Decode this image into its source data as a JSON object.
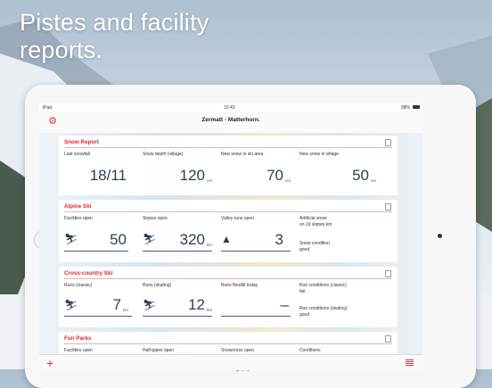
{
  "headline": {
    "line1": "Pistes and facility",
    "line2": "reports."
  },
  "status_bar": {
    "device": "iPad",
    "time": "10:43",
    "battery": "98%"
  },
  "nav": {
    "title": "Zermatt - Matterhorn.",
    "settings_icon": "gear-icon"
  },
  "cards": {
    "snow_report": {
      "title": "Snow Report",
      "items": [
        {
          "label": "Last snowfall",
          "value": "18/11",
          "unit": ""
        },
        {
          "label": "Snow depth (village)",
          "value": "120",
          "unit": "cm"
        },
        {
          "label": "New snow in ski area",
          "value": "70",
          "unit": "cm"
        },
        {
          "label": "New snow in village",
          "value": "50",
          "unit": "cm"
        }
      ]
    },
    "alpine_ski": {
      "title": "Alpine Ski",
      "items": [
        {
          "label": "Facilities open",
          "value": "50",
          "unit": ""
        },
        {
          "label": "Slopes open",
          "value": "320",
          "unit": "km"
        },
        {
          "label": "Valley runs open",
          "value": "3",
          "unit": ""
        }
      ],
      "artificial_label": "Artificial snow",
      "artificial_sub": "on 19 slopes km",
      "condition_label": "Snow condition",
      "condition_value": "good"
    },
    "cross_country": {
      "title": "Cross-country Ski",
      "items": [
        {
          "label": "Runs (classic)",
          "value": "7",
          "unit": "km"
        },
        {
          "label": "Runs (skating)",
          "value": "12",
          "unit": "km"
        },
        {
          "label": "Runs floodlit today",
          "value": "–",
          "unit": ""
        }
      ],
      "cond_classic_label": "Run conditions (classic)",
      "cond_classic_value": "fair",
      "cond_skating_label": "Run conditions (skating)",
      "cond_skating_value": "good"
    },
    "fun_parks": {
      "title": "Fun Parks",
      "items": [
        {
          "label": "Facilities open"
        },
        {
          "label": "Half-pipes open"
        },
        {
          "label": "Snowcross open"
        },
        {
          "label": "Conditions"
        }
      ]
    }
  },
  "tabbar": {
    "add_icon": "plus-icon",
    "list_icon": "list-icon"
  },
  "colors": {
    "accent": "#d8282f",
    "value": "#2f3e54"
  }
}
